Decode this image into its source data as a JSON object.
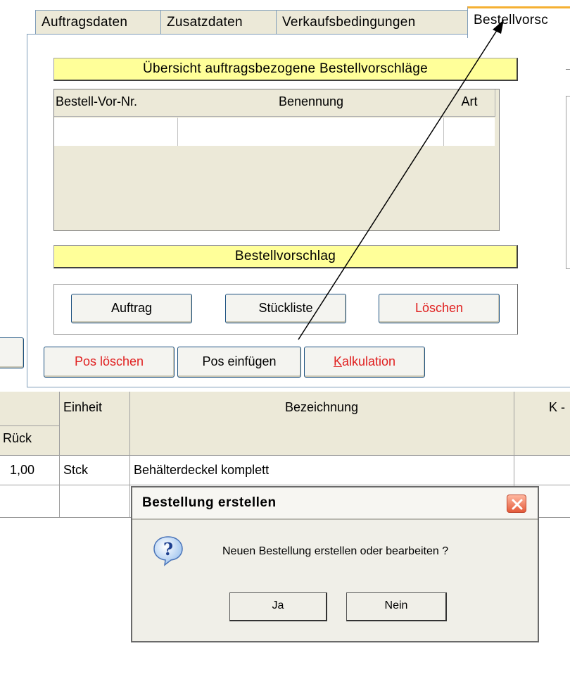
{
  "tabs": [
    "Auftragsdaten",
    "Zusatzdaten",
    "Verkaufsbedingungen",
    "Bestellvorsc"
  ],
  "overview": {
    "header": "Übersicht auftragsbezogene Bestellvorschläge",
    "columns": [
      "Bestell-Vor-Nr.",
      "Benennung",
      "Art"
    ]
  },
  "proposal": {
    "header": "Bestellvorschlag",
    "buttons": {
      "auftrag": "Auftrag",
      "stueckliste": "Stückliste",
      "loeschen": "Löschen"
    }
  },
  "actions": {
    "pos_loeschen": "Pos löschen",
    "pos_einfuegen": "Pos einfügen",
    "kalkulation_accel": "K",
    "kalkulation_rest": "alkulation"
  },
  "table": {
    "headers": {
      "einheit": "Einheit",
      "bezeichnung": "Bezeichnung",
      "k": "K -",
      "rueck": "Rück"
    },
    "row": {
      "menge": "1,00",
      "einheit": "Stck",
      "bezeichnung": "Behälterdeckel komplett"
    }
  },
  "dialog": {
    "title": "Bestellung  erstellen",
    "message": "Neuen Bestellung erstellen oder bearbeiten ?",
    "yes": "Ja",
    "no": "Nein",
    "icon": "question-icon"
  },
  "colors": {
    "yellow": "#ffff99",
    "tab_highlight": "#f5b033",
    "red_text": "#e02020",
    "arrow": "#000000"
  }
}
